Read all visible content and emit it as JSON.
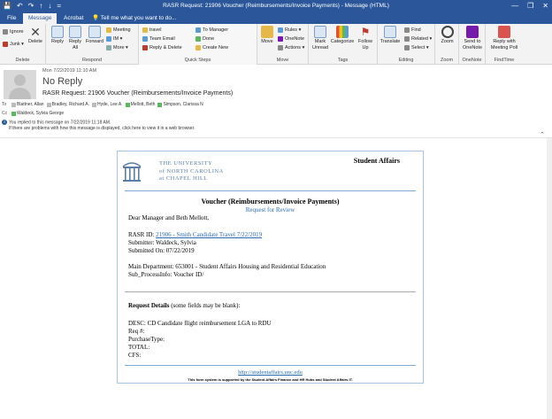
{
  "window": {
    "title": "RASR Request: 21906 Voucher (Reimbursements/Invoice Payments) - Message (HTML)",
    "min": "—",
    "restore": "❐",
    "close": "✕"
  },
  "qat": {
    "save": "💾",
    "undo": "↶",
    "redo": "↷",
    "up": "↑",
    "down": "↓",
    "more": "="
  },
  "tabs": [
    {
      "label": "File"
    },
    {
      "label": "Message"
    },
    {
      "label": "Acrobat"
    }
  ],
  "tellme": "Tell me what you want to do...",
  "ribbon": {
    "delete_group": {
      "label": "Delete",
      "ignore": "Ignore",
      "junk": "Junk ▾",
      "delete": "Delete"
    },
    "respond_group": {
      "label": "Respond",
      "reply": "Reply",
      "reply_all": "Reply All",
      "forward": "Forward",
      "meeting": "Meeting",
      "im": "IM ▾",
      "more": "More ▾"
    },
    "quicksteps_group": {
      "label": "Quick Steps",
      "items": [
        "travel",
        "Team Email",
        "Reply & Delete",
        "To Manager",
        "Done",
        "Create New"
      ]
    },
    "move_group": {
      "label": "Move",
      "move": "Move",
      "rules": "Rules ▾",
      "onenote": "OneNote",
      "actions": "Actions ▾"
    },
    "tags_group": {
      "label": "Tags",
      "mark_unread": "Mark Unread",
      "categorize": "Categorize",
      "follow_up": "Follow Up"
    },
    "editing_group": {
      "label": "Editing",
      "translate": "Translate",
      "find": "Find",
      "related": "Related ▾",
      "select": "Select ▾"
    },
    "zoom_group": {
      "label": "Zoom",
      "zoom": "Zoom"
    },
    "onenote_group": {
      "label": "OneNote",
      "send": "Send to OneNote"
    },
    "findtime_group": {
      "label": "FindTime",
      "reply_poll": "Reply with Meeting Poll"
    }
  },
  "header": {
    "date": "Mon 7/22/2019 11:10 AM",
    "from": "No Reply",
    "subject": "RASR Request: 21906 Voucher (Reimbursements/Invoice Payments)",
    "to_label": "To",
    "to": [
      "Blattner, Allan",
      "Bradley, Richard A.",
      "Hyde, Lee A.",
      "Mellott, Beth",
      "Simpson, Clarissa N"
    ],
    "cc_label": "Cc",
    "cc": "Waldeck, Sylvia George",
    "info1": "You replied to this message on 7/22/2019 11:18 AM.",
    "info2": "If there are problems with how this message is displayed, click here to view it in a web browser."
  },
  "email": {
    "uni1": "THE UNIVERSITY",
    "uni2": "of NORTH CAROLINA",
    "uni3": "at CHAPEL HILL",
    "dept": "Student Affairs",
    "voucher_title": "Voucher (Reimbursements/Invoice Payments)",
    "request_for_review": "Request for Review",
    "greeting": "Dear Manager and Beth Mellott,",
    "rasr_label": "RASR ID: ",
    "rasr_link": "21906 - Smith Candidate Travel 7/22/2019",
    "submitter": "Submitter: Waldeck, Sylvia",
    "submitted_on": "Submitted On: 07/22/2019",
    "main_dept": "Main Department:  653001 - Student Affairs Housing and Residential Education",
    "sub_process": "Sub_ProcessInfo:  Voucher ID/",
    "request_details_bold": "Request Details",
    "request_details_rest": " (some fields may be blank):",
    "desc": "DESC:  CD Candidate flight reimbursement LGA to RDU",
    "req": "Req #:",
    "purchase_type": "PurchaseType:",
    "total": "TOTAL:",
    "cfs": "CFS:",
    "footer_link": "http://studentaffairs.unc.edu",
    "footer_text": "This form system is supported by the Student Affairs Finance and HR Hubs and Student Affairs IT."
  },
  "colors": {
    "accent": "#2b579a",
    "link": "#2b6cb0",
    "unc_blue": "#5a7fa6"
  }
}
